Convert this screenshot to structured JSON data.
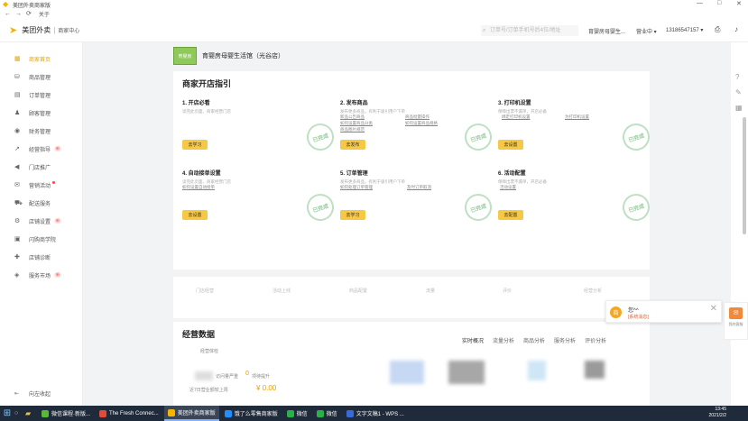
{
  "titlebar": {
    "title": "美团外卖商家版",
    "minimize": "—",
    "maximize": "□",
    "close": "✕"
  },
  "navrow": {
    "back": "←",
    "forward": "→",
    "refresh": "⟳",
    "about": "关于"
  },
  "header": {
    "brand": "美团外卖",
    "brand_sep": "|",
    "brand_sub": "商家中心",
    "search_placeholder": "订单号/订单手机号后4位/地址",
    "shop_short": "育婴房母婴生...",
    "status": "营业中",
    "phone": "13186547157"
  },
  "sidebar": {
    "items": [
      {
        "label": "商家首页",
        "icon": "home-icon",
        "glyph": "▦",
        "active": true
      },
      {
        "label": "商品管理",
        "icon": "goods-icon",
        "glyph": "⛁"
      },
      {
        "label": "订单管理",
        "icon": "order-icon",
        "glyph": "▤"
      },
      {
        "label": "顾客管理",
        "icon": "customer-icon",
        "glyph": "♟"
      },
      {
        "label": "财务管理",
        "icon": "finance-icon",
        "glyph": "◉"
      },
      {
        "label": "经营指导",
        "icon": "guide-icon",
        "glyph": "↗",
        "badge": "新"
      },
      {
        "label": "门店推广",
        "icon": "promo-icon",
        "glyph": "◀"
      },
      {
        "label": "营销活动",
        "icon": "marketing-icon",
        "glyph": "✉",
        "dot": true
      },
      {
        "label": "配送服务",
        "icon": "delivery-icon",
        "glyph": "⛟"
      },
      {
        "label": "店铺设置",
        "icon": "settings-icon",
        "glyph": "⚙",
        "badge": "新"
      },
      {
        "label": "闪购商学院",
        "icon": "school-icon",
        "glyph": "▣"
      },
      {
        "label": "店铺诊断",
        "icon": "diagnose-icon",
        "glyph": "✚"
      },
      {
        "label": "服务市场",
        "icon": "market-icon",
        "glyph": "◈",
        "badge": "新"
      }
    ],
    "bottom": "向左收起"
  },
  "shop": {
    "avatar_text": "育婴房",
    "name": "育婴房母婴生活馆（光谷店）"
  },
  "guide": {
    "title": "商家开店指引",
    "stamp": "已完成",
    "cards": [
      {
        "title": "1. 开店必看",
        "desc": "读完此页面，商家经营门店",
        "links": [],
        "button": "去学习"
      },
      {
        "title": "2. 发布商品",
        "desc": "发布更多商品，有利于吸引用户下单",
        "links": [
          "新品公告商品",
          "商品批量操作",
          "如何设置商品分类",
          "如何设置商品规格",
          "商品图片规范"
        ],
        "button": "去发布"
      },
      {
        "title": "3. 打印机设置",
        "desc": "保障出票不漏单，开店必备",
        "links": [
          "绑定打印机设置",
          "为打印机设置"
        ],
        "button": "去设置"
      },
      {
        "title": "4. 自动接单设置",
        "desc": "读完此页面，商家经营门店",
        "links": [
          "如何设置自动接单"
        ],
        "button": "去设置"
      },
      {
        "title": "5. 订单管理",
        "desc": "发布更多商品，有利于吸引用户下单",
        "links": [
          "如何处理订单管理",
          "及时订单取消"
        ],
        "button": "去学习"
      },
      {
        "title": "6. 活动配置",
        "desc": "保障出票不漏单，开店必备",
        "links": [
          "活动设置"
        ],
        "button": "去配置"
      }
    ]
  },
  "quick": {
    "items": [
      "门店经营",
      "活动上线",
      "商品配置",
      "流量",
      "评价",
      "经营分析"
    ]
  },
  "biz": {
    "title": "经营数据",
    "tabs": [
      "实时概况",
      "流量分析",
      "商品分析",
      "服务分析",
      "评价分析"
    ],
    "sub": "经营体检",
    "visit_label": "访问量严重",
    "visit_value": "0",
    "visit_suffix": "项待提升",
    "revenue_label": "近7日营业额较上周",
    "revenue_value": "¥ 0.00"
  },
  "chat": {
    "avatar": "商",
    "name": "您^^",
    "sub": "[系统消息]",
    "close": "✕"
  },
  "service": {
    "label": "我的客服",
    "glyph": "✉"
  },
  "taskbar": {
    "tasks": [
      {
        "label": "微信课程·新版...",
        "color": "#59b83a"
      },
      {
        "label": "The Fresh Connec...",
        "color": "#e44a3a"
      },
      {
        "label": "美团外卖商家版",
        "color": "#f5b400",
        "on": true
      },
      {
        "label": "饿了么零售商家版",
        "color": "#1e90ff"
      },
      {
        "label": "微信",
        "color": "#2ab24a"
      },
      {
        "label": "微信",
        "color": "#2ab24a"
      },
      {
        "label": "文字文稿1 - WPS ...",
        "color": "#3a6ad8"
      }
    ],
    "time": "13:45",
    "date": "2021/2/2"
  }
}
